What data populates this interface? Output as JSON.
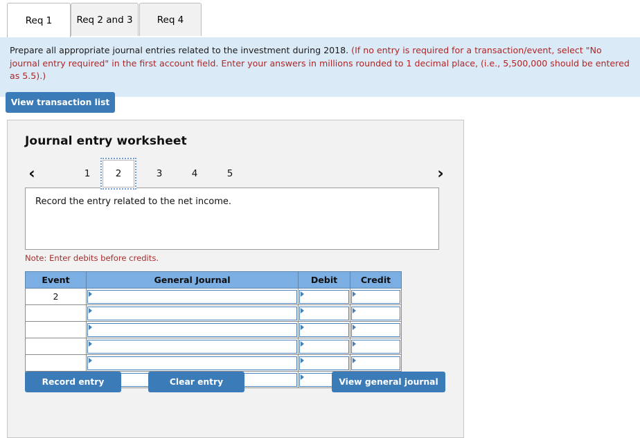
{
  "tabs": [
    {
      "label": "Req 1",
      "active": true
    },
    {
      "label": "Req 2 and 3",
      "active": false
    },
    {
      "label": "Req 4",
      "active": false
    }
  ],
  "banner": {
    "lead": "Prepare all appropriate journal entries related to the investment during 2018. ",
    "note": "(If no entry is required for a transaction/event, select \"No journal entry required\" in the first account field. Enter your answers in millions rounded to 1 decimal place, (i.e., 5,500,000 should be entered as 5.5).)"
  },
  "toolbar": {
    "view_transaction_list_label": "View transaction list"
  },
  "worksheet": {
    "title": "Journal entry worksheet",
    "pager": {
      "prev_icon": "chevron-left-icon",
      "next_icon": "chevron-right-icon",
      "prev_glyph": "‹",
      "next_glyph": "›",
      "pages": [
        "1",
        "2",
        "3",
        "4",
        "5"
      ],
      "current_page": "2"
    },
    "description": "Record the entry related to the net income.",
    "note": "Note: Enter debits before credits.",
    "table": {
      "columns": [
        "Event",
        "General Journal",
        "Debit",
        "Credit"
      ],
      "rows": [
        {
          "event": "2",
          "general_journal": "",
          "debit": "",
          "credit": ""
        },
        {
          "event": "",
          "general_journal": "",
          "debit": "",
          "credit": ""
        },
        {
          "event": "",
          "general_journal": "",
          "debit": "",
          "credit": ""
        },
        {
          "event": "",
          "general_journal": "",
          "debit": "",
          "credit": ""
        },
        {
          "event": "",
          "general_journal": "",
          "debit": "",
          "credit": ""
        },
        {
          "event": "",
          "general_journal": "",
          "debit": "",
          "credit": ""
        }
      ]
    },
    "buttons": {
      "record_entry": "Record entry",
      "clear_entry": "Clear entry",
      "view_general_journal": "View general journal"
    }
  },
  "colors": {
    "button_blue": "#3b7cb8",
    "table_header_blue": "#7bafe3",
    "banner_blue": "#dbeaf7",
    "note_red": "#a82c2c",
    "panel_gray": "#f2f2f2",
    "input_border_blue": "#4b7fb5"
  }
}
